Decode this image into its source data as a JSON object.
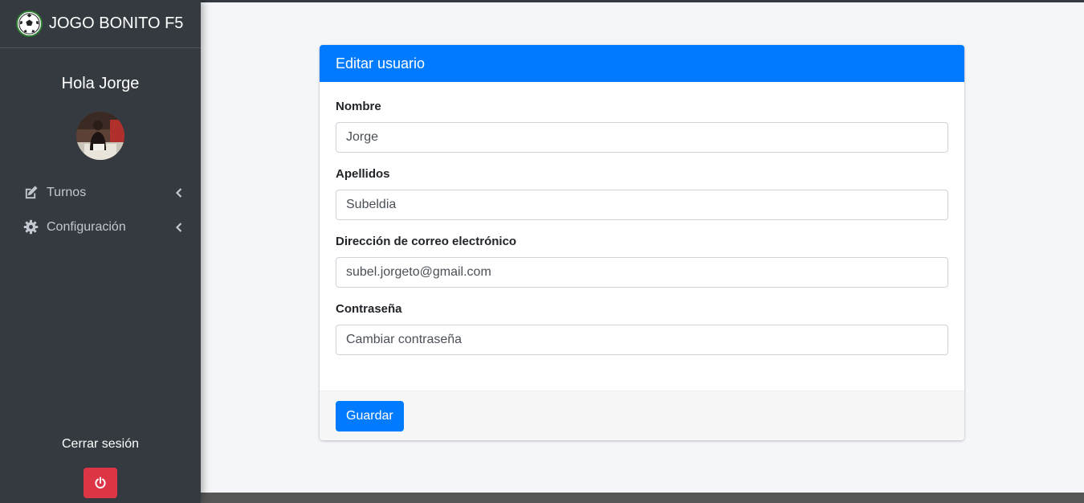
{
  "brand": {
    "name": "JOGO BONITO F5",
    "logo_icon": "soccer-ball-icon"
  },
  "sidebar": {
    "greeting": "Hola Jorge",
    "avatar_icon": "user-avatar",
    "items": [
      {
        "label": "Turnos",
        "icon": "edit-icon"
      },
      {
        "label": "Configuración",
        "icon": "gear-icon"
      }
    ],
    "logout_label": "Cerrar sesión",
    "logout_icon": "power-icon"
  },
  "form": {
    "title": "Editar usuario",
    "fields": [
      {
        "label": "Nombre",
        "value": "Jorge",
        "placeholder": ""
      },
      {
        "label": "Apellidos",
        "value": "Subeldia",
        "placeholder": ""
      },
      {
        "label": "Dirección de correo electrónico",
        "value": "subel.jorgeto@gmail.com",
        "placeholder": ""
      },
      {
        "label": "Contraseña",
        "value": "",
        "placeholder": "Cambiar contraseña"
      }
    ],
    "save_label": "Guardar"
  },
  "colors": {
    "sidebar_bg": "#343a40",
    "primary": "#007bff",
    "danger": "#dc3545",
    "content_bg": "#f4f6f9"
  }
}
